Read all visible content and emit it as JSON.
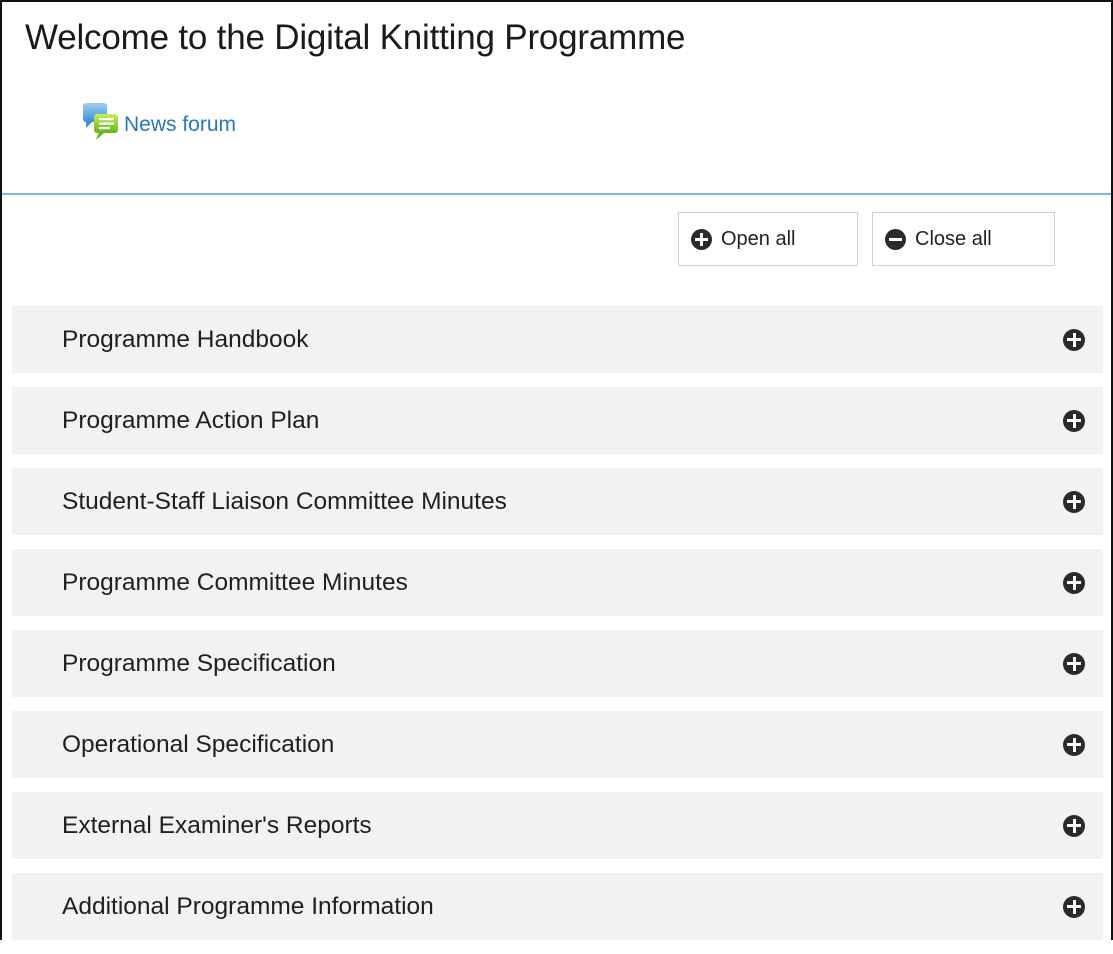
{
  "page": {
    "title": "Welcome to the Digital Knitting Programme"
  },
  "news_forum": {
    "label": "News forum",
    "icon": "forum-icon"
  },
  "controls": {
    "open_all_label": "Open all",
    "close_all_label": "Close all"
  },
  "sections": [
    {
      "title": "Programme Handbook",
      "icon": "plus-circle-icon"
    },
    {
      "title": "Programme Action Plan",
      "icon": "plus-circle-icon"
    },
    {
      "title": "Student-Staff Liaison Committee Minutes",
      "icon": "plus-circle-icon"
    },
    {
      "title": "Programme Committee Minutes",
      "icon": "plus-circle-icon"
    },
    {
      "title": "Programme Specification",
      "icon": "plus-circle-icon"
    },
    {
      "title": "Operational Specification",
      "icon": "plus-circle-icon"
    },
    {
      "title": "External Examiner's Reports",
      "icon": "plus-circle-icon"
    },
    {
      "title": "Additional Programme Information",
      "icon": "plus-circle-icon"
    }
  ],
  "colors": {
    "link": "#2b78b6",
    "divider": "#74b9e0",
    "section_bg": "#f2f2f2",
    "icon_dark": "#2a2a2a"
  }
}
